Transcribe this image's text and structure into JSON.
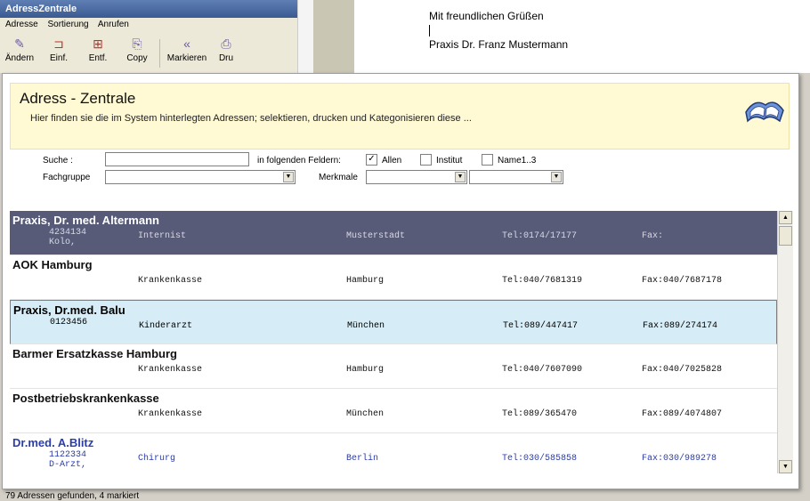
{
  "bgwin": {
    "title": "AdressZentrale",
    "menu": [
      "Adresse",
      "Sortierung",
      "Anrufen"
    ],
    "toolbar": [
      {
        "label": "Ändern",
        "icon": "eraser-icon",
        "glyph": "✎"
      },
      {
        "label": "Einf.",
        "icon": "insert-icon",
        "glyph": "⊐"
      },
      {
        "label": "Entf.",
        "icon": "delete-icon",
        "glyph": "⊞"
      },
      {
        "label": "Copy",
        "icon": "copy-icon",
        "glyph": "⎘"
      },
      {
        "label": "Markieren",
        "icon": "mark-icon",
        "glyph": "«"
      },
      {
        "label": "Dru",
        "icon": "print-icon",
        "glyph": "⎙"
      }
    ]
  },
  "letter": {
    "line1": "Mit freundlichen Grüßen",
    "line2": "Praxis Dr. Franz Mustermann"
  },
  "dialog": {
    "title": "Adress - Zentrale",
    "description": "Hier finden sie die im System hinterlegten Adressen; selektieren, drucken und Kategonisieren diese ...",
    "search_label": "Suche :",
    "search_value": "",
    "fields_label": "in folgenden Feldern:",
    "checkboxes": [
      {
        "label": "Allen",
        "checked": true
      },
      {
        "label": "Institut",
        "checked": false
      },
      {
        "label": "Name1..3",
        "checked": false
      }
    ],
    "fachgruppe_label": "Fachgruppe",
    "fachgruppe_value": "",
    "merkmale_label": "Merkmale",
    "merkmal1_value": "",
    "merkmal2_value": ""
  },
  "colors": {
    "row_dark": "#575b78",
    "row_selected": "#d6ecf6",
    "row_blue_text": "#2b3da8",
    "header_bg": "#fff9d4"
  },
  "rows": [
    {
      "name": "Praxis, Dr. med. Altermann",
      "id": "4234134",
      "id2": "Kolo,",
      "type": "Internist",
      "city": "Musterstadt",
      "tel": "Tel:0174/17177",
      "fax": "Fax:",
      "style": "dark"
    },
    {
      "name": "AOK Hamburg",
      "id": "",
      "id2": "",
      "type": "Krankenkasse",
      "city": "Hamburg",
      "tel": "Tel:040/7681319",
      "fax": "Fax:040/7687178",
      "style": "white"
    },
    {
      "name": "Praxis, Dr.med. Balu",
      "id": "0123456",
      "id2": "",
      "type": "Kinderarzt",
      "city": "München",
      "tel": "Tel:089/447417",
      "fax": "Fax:089/274174",
      "style": "sel"
    },
    {
      "name": "Barmer Ersatzkasse Hamburg",
      "id": "",
      "id2": "",
      "type": "Krankenkasse",
      "city": "Hamburg",
      "tel": "Tel:040/7607090",
      "fax": "Fax:040/7025828",
      "style": "white"
    },
    {
      "name": "Postbetriebskrankenkasse",
      "id": "",
      "id2": "",
      "type": "Krankenkasse",
      "city": "München",
      "tel": "Tel:089/365470",
      "fax": "Fax:089/4074807",
      "style": "white"
    },
    {
      "name": "Dr.med. A.Blitz",
      "id": "1122334",
      "id2": "D-Arzt,",
      "type": "Chirurg",
      "city": "Berlin",
      "tel": "Tel:030/585858",
      "fax": "Fax:030/989278",
      "style": "blue"
    }
  ],
  "status": "79 Adressen gefunden, 4 markiert"
}
